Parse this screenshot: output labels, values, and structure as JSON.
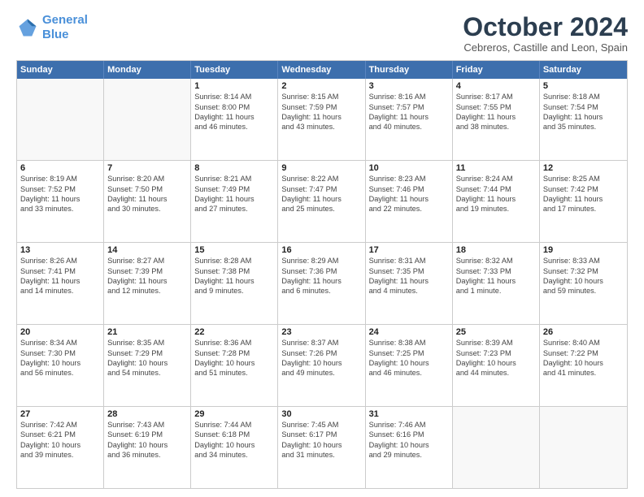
{
  "logo": {
    "line1": "General",
    "line2": "Blue"
  },
  "title": "October 2024",
  "subtitle": "Cebreros, Castille and Leon, Spain",
  "header_days": [
    "Sunday",
    "Monday",
    "Tuesday",
    "Wednesday",
    "Thursday",
    "Friday",
    "Saturday"
  ],
  "weeks": [
    [
      {
        "day": "",
        "lines": []
      },
      {
        "day": "",
        "lines": []
      },
      {
        "day": "1",
        "lines": [
          "Sunrise: 8:14 AM",
          "Sunset: 8:00 PM",
          "Daylight: 11 hours",
          "and 46 minutes."
        ]
      },
      {
        "day": "2",
        "lines": [
          "Sunrise: 8:15 AM",
          "Sunset: 7:59 PM",
          "Daylight: 11 hours",
          "and 43 minutes."
        ]
      },
      {
        "day": "3",
        "lines": [
          "Sunrise: 8:16 AM",
          "Sunset: 7:57 PM",
          "Daylight: 11 hours",
          "and 40 minutes."
        ]
      },
      {
        "day": "4",
        "lines": [
          "Sunrise: 8:17 AM",
          "Sunset: 7:55 PM",
          "Daylight: 11 hours",
          "and 38 minutes."
        ]
      },
      {
        "day": "5",
        "lines": [
          "Sunrise: 8:18 AM",
          "Sunset: 7:54 PM",
          "Daylight: 11 hours",
          "and 35 minutes."
        ]
      }
    ],
    [
      {
        "day": "6",
        "lines": [
          "Sunrise: 8:19 AM",
          "Sunset: 7:52 PM",
          "Daylight: 11 hours",
          "and 33 minutes."
        ]
      },
      {
        "day": "7",
        "lines": [
          "Sunrise: 8:20 AM",
          "Sunset: 7:50 PM",
          "Daylight: 11 hours",
          "and 30 minutes."
        ]
      },
      {
        "day": "8",
        "lines": [
          "Sunrise: 8:21 AM",
          "Sunset: 7:49 PM",
          "Daylight: 11 hours",
          "and 27 minutes."
        ]
      },
      {
        "day": "9",
        "lines": [
          "Sunrise: 8:22 AM",
          "Sunset: 7:47 PM",
          "Daylight: 11 hours",
          "and 25 minutes."
        ]
      },
      {
        "day": "10",
        "lines": [
          "Sunrise: 8:23 AM",
          "Sunset: 7:46 PM",
          "Daylight: 11 hours",
          "and 22 minutes."
        ]
      },
      {
        "day": "11",
        "lines": [
          "Sunrise: 8:24 AM",
          "Sunset: 7:44 PM",
          "Daylight: 11 hours",
          "and 19 minutes."
        ]
      },
      {
        "day": "12",
        "lines": [
          "Sunrise: 8:25 AM",
          "Sunset: 7:42 PM",
          "Daylight: 11 hours",
          "and 17 minutes."
        ]
      }
    ],
    [
      {
        "day": "13",
        "lines": [
          "Sunrise: 8:26 AM",
          "Sunset: 7:41 PM",
          "Daylight: 11 hours",
          "and 14 minutes."
        ]
      },
      {
        "day": "14",
        "lines": [
          "Sunrise: 8:27 AM",
          "Sunset: 7:39 PM",
          "Daylight: 11 hours",
          "and 12 minutes."
        ]
      },
      {
        "day": "15",
        "lines": [
          "Sunrise: 8:28 AM",
          "Sunset: 7:38 PM",
          "Daylight: 11 hours",
          "and 9 minutes."
        ]
      },
      {
        "day": "16",
        "lines": [
          "Sunrise: 8:29 AM",
          "Sunset: 7:36 PM",
          "Daylight: 11 hours",
          "and 6 minutes."
        ]
      },
      {
        "day": "17",
        "lines": [
          "Sunrise: 8:31 AM",
          "Sunset: 7:35 PM",
          "Daylight: 11 hours",
          "and 4 minutes."
        ]
      },
      {
        "day": "18",
        "lines": [
          "Sunrise: 8:32 AM",
          "Sunset: 7:33 PM",
          "Daylight: 11 hours",
          "and 1 minute."
        ]
      },
      {
        "day": "19",
        "lines": [
          "Sunrise: 8:33 AM",
          "Sunset: 7:32 PM",
          "Daylight: 10 hours",
          "and 59 minutes."
        ]
      }
    ],
    [
      {
        "day": "20",
        "lines": [
          "Sunrise: 8:34 AM",
          "Sunset: 7:30 PM",
          "Daylight: 10 hours",
          "and 56 minutes."
        ]
      },
      {
        "day": "21",
        "lines": [
          "Sunrise: 8:35 AM",
          "Sunset: 7:29 PM",
          "Daylight: 10 hours",
          "and 54 minutes."
        ]
      },
      {
        "day": "22",
        "lines": [
          "Sunrise: 8:36 AM",
          "Sunset: 7:28 PM",
          "Daylight: 10 hours",
          "and 51 minutes."
        ]
      },
      {
        "day": "23",
        "lines": [
          "Sunrise: 8:37 AM",
          "Sunset: 7:26 PM",
          "Daylight: 10 hours",
          "and 49 minutes."
        ]
      },
      {
        "day": "24",
        "lines": [
          "Sunrise: 8:38 AM",
          "Sunset: 7:25 PM",
          "Daylight: 10 hours",
          "and 46 minutes."
        ]
      },
      {
        "day": "25",
        "lines": [
          "Sunrise: 8:39 AM",
          "Sunset: 7:23 PM",
          "Daylight: 10 hours",
          "and 44 minutes."
        ]
      },
      {
        "day": "26",
        "lines": [
          "Sunrise: 8:40 AM",
          "Sunset: 7:22 PM",
          "Daylight: 10 hours",
          "and 41 minutes."
        ]
      }
    ],
    [
      {
        "day": "27",
        "lines": [
          "Sunrise: 7:42 AM",
          "Sunset: 6:21 PM",
          "Daylight: 10 hours",
          "and 39 minutes."
        ]
      },
      {
        "day": "28",
        "lines": [
          "Sunrise: 7:43 AM",
          "Sunset: 6:19 PM",
          "Daylight: 10 hours",
          "and 36 minutes."
        ]
      },
      {
        "day": "29",
        "lines": [
          "Sunrise: 7:44 AM",
          "Sunset: 6:18 PM",
          "Daylight: 10 hours",
          "and 34 minutes."
        ]
      },
      {
        "day": "30",
        "lines": [
          "Sunrise: 7:45 AM",
          "Sunset: 6:17 PM",
          "Daylight: 10 hours",
          "and 31 minutes."
        ]
      },
      {
        "day": "31",
        "lines": [
          "Sunrise: 7:46 AM",
          "Sunset: 6:16 PM",
          "Daylight: 10 hours",
          "and 29 minutes."
        ]
      },
      {
        "day": "",
        "lines": []
      },
      {
        "day": "",
        "lines": []
      }
    ]
  ]
}
